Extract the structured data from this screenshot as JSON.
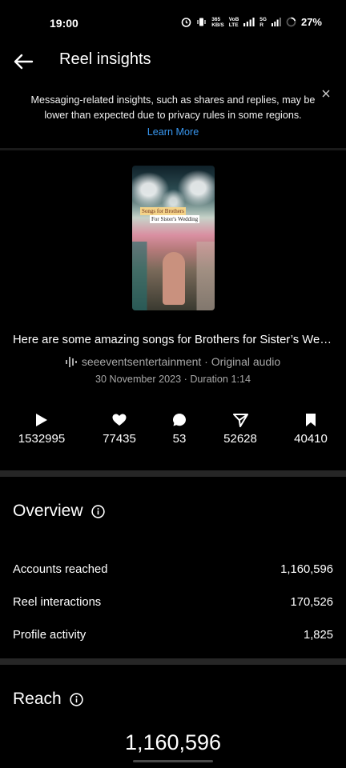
{
  "status_bar": {
    "time": "19:00",
    "net_speed_value": "365",
    "net_speed_unit": "KB/S",
    "volte_top": "VoB",
    "volte_bottom": "LTE",
    "fiveg_top": "5G",
    "fiveg_bottom": "R",
    "battery": "27%"
  },
  "header": {
    "title": "Reel insights"
  },
  "banner": {
    "text": "Messaging-related insights, such as shares and replies, may be lower than expected due to privacy rules in some regions.",
    "link": "Learn More"
  },
  "thumbnail": {
    "overlay_line1": "Songs for Brothers",
    "overlay_line2": "For Sister's Wedding"
  },
  "reel": {
    "caption": "Here are some amazing songs for Brothers for Sister’s Wed...",
    "audio": "seeeventsentertainment · Original audio",
    "date_duration": "30 November 2023 · Duration 1:14"
  },
  "stats": [
    {
      "icon": "play-icon",
      "value": "1532995"
    },
    {
      "icon": "heart-icon",
      "value": "77435"
    },
    {
      "icon": "comment-icon",
      "value": "53"
    },
    {
      "icon": "share-icon",
      "value": "52628"
    },
    {
      "icon": "save-icon",
      "value": "40410"
    }
  ],
  "overview": {
    "title": "Overview",
    "rows": [
      {
        "label": "Accounts reached",
        "value": "1,160,596"
      },
      {
        "label": "Reel interactions",
        "value": "170,526"
      },
      {
        "label": "Profile activity",
        "value": "1,825"
      }
    ]
  },
  "reach": {
    "title": "Reach",
    "value": "1,160,596"
  },
  "colors": {
    "background": "#000000",
    "link": "#3897f0",
    "secondary_text": "#a8a8a8",
    "divider": "#262626"
  }
}
